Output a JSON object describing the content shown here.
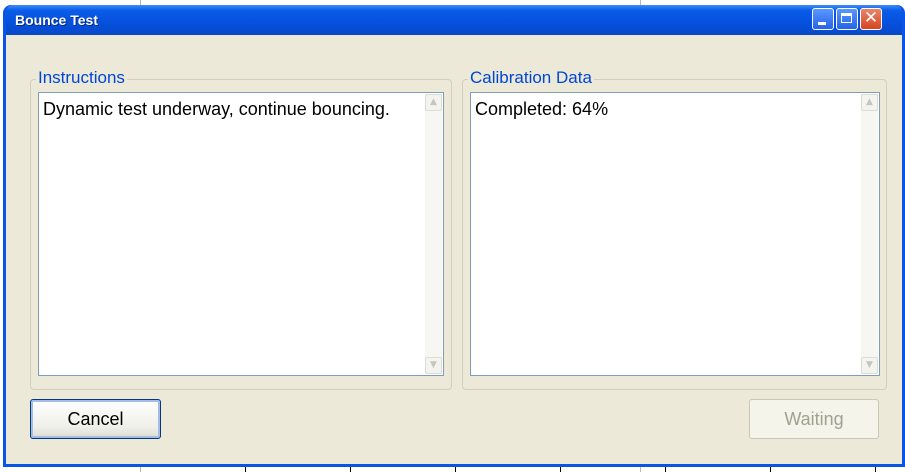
{
  "window": {
    "title": "Bounce Test",
    "controls": {
      "minimize": "minimize-icon",
      "maximize": "maximize-icon",
      "close": "close-icon"
    },
    "accent_color": "#0a55e6"
  },
  "instructions": {
    "label": "Instructions",
    "text": "Dynamic test underway, continue bouncing."
  },
  "calibration": {
    "label": "Calibration Data",
    "text": "Completed: 64%"
  },
  "buttons": {
    "cancel": "Cancel",
    "waiting": "Waiting"
  }
}
